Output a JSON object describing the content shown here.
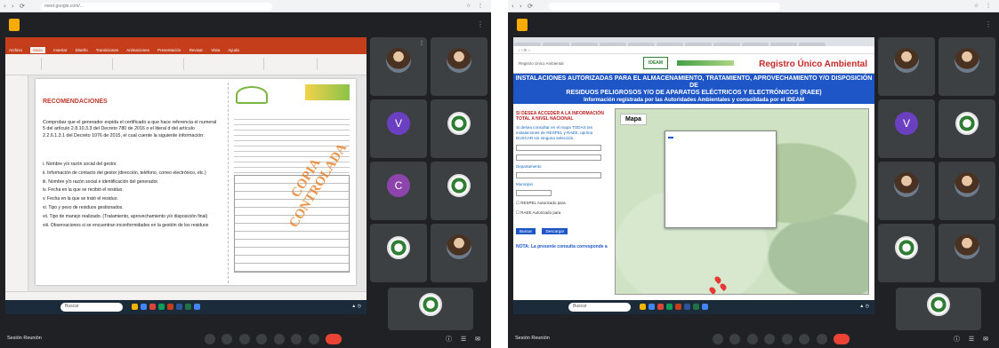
{
  "left": {
    "browser_url": "meet.google.com/...",
    "meeting_title": "",
    "presentation": {
      "window_title": "",
      "tabs": [
        "Archivo",
        "Inicio",
        "Insertar",
        "Diseño",
        "Transiciones",
        "Animaciones",
        "Presentación",
        "Revisar",
        "Vista",
        "Ayuda"
      ],
      "active_tab": "Inicio",
      "slide": {
        "heading": "RECOMENDACIONES",
        "paragraph": "Comprobar que el generador expida el certificado a que hace referencia el numeral 5 del artículo 2.8.10.3.3 del Decreto 780 de 2016 o el literal d del artículo 2.2.6.1.3.1 del Decreto 1076 de 2015, el cual cuente la siguiente información:",
        "items": [
          "i. Nombre y/o razón social del gestor.",
          "ii. Información de contacto del gestor (dirección, teléfono, correo electrónico, etc.)",
          "iii. Nombre y/o razón social e identificación del generador.",
          "iv. Fecha en la que se recibió el residuo.",
          "v. Fecha en la que se trató el residuo.",
          "vi. Tipo y peso de residuos gestionados.",
          "vii. Tipo de manejo realizado. (Tratamiento, aprovechamiento y/o disposición final)",
          "viii. Observaciones si se encuentran inconformidades en la gestión de los residuos"
        ],
        "stamp": "COPIA CONTROLADA"
      },
      "taskbar_search": "Buscar"
    },
    "bottom_bar_time": "Sesión Reunión",
    "participants": [
      {
        "name": "",
        "kind": "photo"
      },
      {
        "name": "",
        "kind": "photo"
      },
      {
        "name": "",
        "letter": "V",
        "color": "#6a3fc0"
      },
      {
        "name": "",
        "kind": "ring"
      },
      {
        "name": "",
        "letter": "C",
        "color": "#8e44ad"
      },
      {
        "name": "",
        "kind": "ring"
      },
      {
        "name": "",
        "kind": "ring"
      },
      {
        "name": "",
        "kind": "photo"
      }
    ],
    "self_tile_name": ""
  },
  "right": {
    "browser_url": "",
    "meeting_title": "",
    "site": {
      "banner_left": "Registro Único Ambiental",
      "ideam_logo": "IDEAM",
      "banner_right": "Registro Único Ambiental",
      "hero_line1": "INSTALACIONES AUTORIZADAS PARA EL ALMACENAMIENTO, TRATAMIENTO, APROVECHAMIENTO Y/O DISPOSICIÓN DE",
      "hero_line2": "RESIDUOS PELIGROSOS Y/O DE APARATOS ELÉCTRICOS Y ELECTRÓNICOS (RAEE)",
      "hero_line3": "Información registrada por las Autoridades Ambientales y consolidada por el IDEAM",
      "form": {
        "updated": "",
        "intro": "SI DESEA ACCEDER A LA INFORMACIÓN TOTAL A NIVEL NACIONAL",
        "hint": "Si desea consultar en el mapa TODAS las instalaciones de RESPEL y RAEE, oprima BUSCAR sin ninguna selección.",
        "field1_label": "",
        "field2_label": "",
        "dept_label": "Departamento",
        "muni_label": "Municipio",
        "opt1": "RESPEL Autorizado para",
        "opt2": "RAEE Autorizado para",
        "btn_search": "Buscar",
        "btn_clear": "Descargar",
        "note": "NOTA: La presente consulta corresponde a"
      },
      "map": {
        "tag": "Mapa",
        "popup_title": "",
        "popup_lines": [],
        "popup_button": ""
      }
    },
    "bottom_bar_time": "Sesión Reunión",
    "participants": [
      {
        "name": "",
        "kind": "photo"
      },
      {
        "name": "",
        "kind": "photo"
      },
      {
        "name": "",
        "letter": "V",
        "color": "#6a3fc0"
      },
      {
        "name": "",
        "kind": "ring"
      },
      {
        "name": "",
        "kind": "photo"
      },
      {
        "name": "",
        "kind": "photo"
      },
      {
        "name": "",
        "kind": "ring"
      },
      {
        "name": "",
        "kind": "photo"
      }
    ],
    "self_tile_name": ""
  },
  "colors": {
    "meet_bg": "#202124",
    "tile_bg": "#3c4043",
    "ppt_red": "#c43e1c",
    "ideam_blue": "#1e56c8",
    "rua_red": "#c62828",
    "end_call": "#ea4335"
  },
  "icons": {
    "mic": "microphone-icon",
    "camera": "camera-icon",
    "end_call": "end-call-icon",
    "more": "more-vertical-icon",
    "meet_logo": "meet-logo-icon"
  }
}
